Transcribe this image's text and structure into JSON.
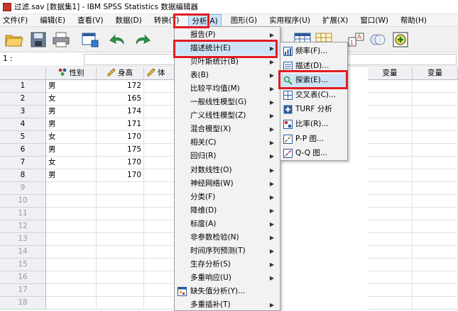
{
  "window": {
    "title": "过滤.sav [数据集1] - IBM SPSS Statistics 数据编辑器"
  },
  "menubar": [
    {
      "label": "文件(F)"
    },
    {
      "label": "编辑(E)"
    },
    {
      "label": "查看(V)"
    },
    {
      "label": "数据(D)"
    },
    {
      "label": "转换(T)"
    },
    {
      "label": "分析(A)"
    },
    {
      "label": "图形(G)"
    },
    {
      "label": "实用程序(U)"
    },
    {
      "label": "扩展(X)"
    },
    {
      "label": "窗口(W)"
    },
    {
      "label": "帮助(H)"
    }
  ],
  "refbar": {
    "cell_ref": "1 :"
  },
  "grid": {
    "columns": [
      {
        "label": "性别",
        "icon": "nominal-icon"
      },
      {
        "label": "身高",
        "icon": "scale-icon"
      },
      {
        "label": "体",
        "icon": "scale-icon"
      },
      {
        "label": "变量"
      },
      {
        "label": "变量"
      }
    ],
    "row_numbers": [
      "1",
      "2",
      "3",
      "4",
      "5",
      "6",
      "7",
      "8",
      "9",
      "10",
      "11",
      "12",
      "13",
      "14",
      "15",
      "16",
      "17",
      "18"
    ],
    "rows": [
      {
        "gender": "男",
        "height": "172"
      },
      {
        "gender": "女",
        "height": "165"
      },
      {
        "gender": "男",
        "height": "174"
      },
      {
        "gender": "男",
        "height": "171"
      },
      {
        "gender": "女",
        "height": "170"
      },
      {
        "gender": "男",
        "height": "175"
      },
      {
        "gender": "女",
        "height": "170"
      },
      {
        "gender": "男",
        "height": "170"
      }
    ]
  },
  "analyze_menu": [
    {
      "label": "报告(P)",
      "arrow": "▶"
    },
    {
      "label": "描述统计(E)",
      "arrow": "▶"
    },
    {
      "label": "贝叶斯统计(B)",
      "arrow": "▶"
    },
    {
      "label": "表(B)",
      "arrow": "▶"
    },
    {
      "label": "比较平均值(M)",
      "arrow": "▶"
    },
    {
      "label": "一般线性模型(G)",
      "arrow": "▶"
    },
    {
      "label": "广义线性模型(Z)",
      "arrow": "▶"
    },
    {
      "label": "混合模型(X)",
      "arrow": "▶"
    },
    {
      "label": "相关(C)",
      "arrow": "▶"
    },
    {
      "label": "回归(R)",
      "arrow": "▶"
    },
    {
      "label": "对数线性(O)",
      "arrow": "▶"
    },
    {
      "label": "神经网络(W)",
      "arrow": "▶"
    },
    {
      "label": "分类(F)",
      "arrow": "▶"
    },
    {
      "label": "降维(D)",
      "arrow": "▶"
    },
    {
      "label": "标度(A)",
      "arrow": "▶"
    },
    {
      "label": "非参数检验(N)",
      "arrow": "▶"
    },
    {
      "label": "时间序列预测(T)",
      "arrow": "▶"
    },
    {
      "label": "生存分析(S)",
      "arrow": "▶"
    },
    {
      "label": "多重响应(U)",
      "arrow": "▶"
    },
    {
      "label": "缺失值分析(Y)...",
      "arrow": ""
    },
    {
      "label": "多重插补(T)",
      "arrow": "▶"
    }
  ],
  "descriptive_submenu": [
    {
      "label": "频率(F)..."
    },
    {
      "label": "描述(D)..."
    },
    {
      "label": "探索(E)..."
    },
    {
      "label": "交叉表(C)..."
    },
    {
      "label": "TURF 分析"
    },
    {
      "label": "比率(R)..."
    },
    {
      "label": "P-P 图..."
    },
    {
      "label": "Q-Q 图..."
    }
  ],
  "colors": {
    "highlight": "#cfe3f7",
    "annotation_red": "#e31b23"
  }
}
